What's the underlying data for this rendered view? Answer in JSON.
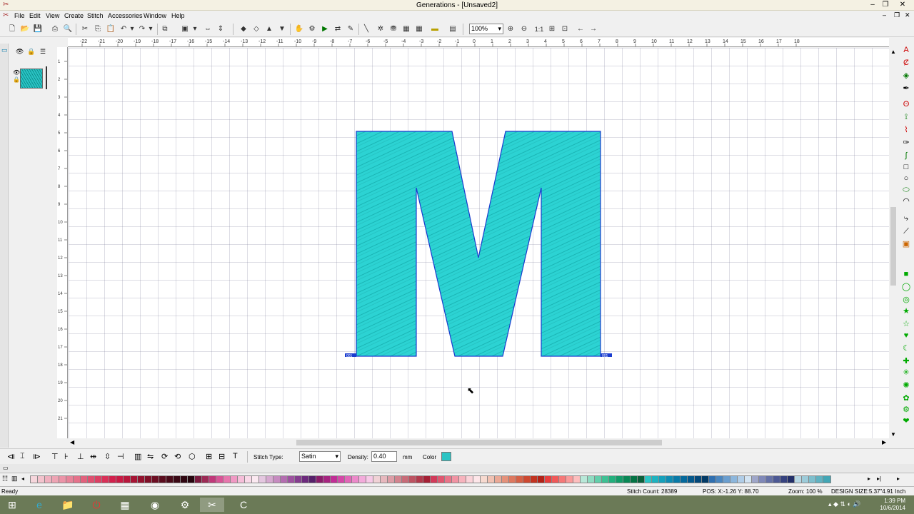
{
  "window": {
    "title": "Generations - [Unsaved2]",
    "minimize": "–",
    "maximize": "❐",
    "close": "✕"
  },
  "menu": [
    "File",
    "Edit",
    "View",
    "Create",
    "Stitch",
    "Accessories",
    "Window",
    "Help"
  ],
  "toolbar": {
    "zoom_value": "100%"
  },
  "ruler": {
    "top_labels": [
      "-22",
      "-21",
      "-20",
      "-19",
      "-18",
      "-17",
      "-16",
      "-15",
      "-14",
      "-13",
      "-12",
      "-11",
      "-10",
      "-9",
      "-8",
      "-7",
      "-6",
      "-5",
      "-4",
      "-3",
      "-2",
      "-1",
      "0",
      "1",
      "2",
      "3",
      "4",
      "5",
      "6",
      "7",
      "8",
      "9",
      "10",
      "11",
      "12",
      "13",
      "14",
      "15",
      "16",
      "17",
      "18"
    ],
    "left_labels": [
      "1",
      "2",
      "3",
      "4",
      "5",
      "6",
      "7",
      "8",
      "9",
      "10",
      "11",
      "12",
      "13",
      "14",
      "15",
      "16",
      "17",
      "18",
      "19",
      "20",
      "21",
      "22"
    ]
  },
  "design": {
    "letter": "M",
    "fill_color": "#2cd3d3",
    "stitch_color": "#0b9b9b",
    "outline_color": "#1a3ccf",
    "handle_left": "001",
    "handle_right": "001"
  },
  "properties": {
    "stitch_type_label": "Stitch Type:",
    "stitch_type_value": "Satin",
    "density_label": "Density:",
    "density_value": "0.40",
    "density_unit": "mm",
    "color_label": "Color",
    "color_value": "#2cc4c4"
  },
  "palette": [
    "#f6d6dc",
    "#f3c3cd",
    "#f0b0bf",
    "#eea4b4",
    "#ec94a8",
    "#e88399",
    "#e5728b",
    "#e2617d",
    "#df5070",
    "#dc4064",
    "#d93058",
    "#d2204c",
    "#c91a44",
    "#b8173c",
    "#a61434",
    "#93122e",
    "#7f1028",
    "#6c0e23",
    "#5a0c1e",
    "#490a19",
    "#3a0815",
    "#2f0611",
    "#26050e",
    "#7a1a3e",
    "#9c2a55",
    "#c0387a",
    "#d85496",
    "#e776ad",
    "#f099c4",
    "#f6bed9",
    "#f9d9e8",
    "#fbe9f1",
    "#e4c7e0",
    "#d6a9d0",
    "#c68bc0",
    "#b36db0",
    "#9d52a0",
    "#853d8f",
    "#6d2a7d",
    "#56206a",
    "#8a1c6a",
    "#a62480",
    "#c12e96",
    "#d448a8",
    "#e266b8",
    "#ec89ca",
    "#f3abdb",
    "#f7c9e7",
    "#f0d2d6",
    "#e7b8be",
    "#dd9ea7",
    "#d3848f",
    "#c86b78",
    "#bd5261",
    "#b2394b",
    "#a52035",
    "#d23a5a",
    "#e0566f",
    "#ea7489",
    "#f193a3",
    "#f7b3bd",
    "#fbd3d9",
    "#fde6e9",
    "#f7dad0",
    "#f1c2b3",
    "#eba996",
    "#e5917a",
    "#de785f",
    "#d66045",
    "#cd4830",
    "#c23320",
    "#b32117",
    "#e83e3e",
    "#f05858",
    "#f57878",
    "#fa9a9a",
    "#fdbebe",
    "#b8e8d8",
    "#8fdcc2",
    "#63cfab",
    "#3ec194",
    "#22b07d",
    "#129c68",
    "#088855",
    "#047344",
    "#0b5f3b",
    "#2cc4c4",
    "#1eb3c0",
    "#14a0bb",
    "#0d8cb3",
    "#087aa8",
    "#05699c",
    "#04588c",
    "#03487a",
    "#023a66",
    "#2f6fb0",
    "#4a86c0",
    "#6a9ecf",
    "#8cb6dc",
    "#b0cde8",
    "#d3e4f3",
    "#9fa6c9",
    "#7f88b8",
    "#6470a6",
    "#4c5894",
    "#36427f",
    "#232f69",
    "#b7d7e4",
    "#9ccbd9",
    "#7ebfcd",
    "#60b2c1",
    "#42a6b5"
  ],
  "status": {
    "ready": "Ready",
    "stitch_count": "Stitch Count:  28389",
    "pos": "POS: X:-1.26     Y: 88.70",
    "zoom": "Zoom:  100 %",
    "design_size": "DESIGN SIZE:5.37\"4.91 Inch"
  },
  "taskbar": {
    "time": "1:39 PM",
    "date": "10/6/2014"
  }
}
